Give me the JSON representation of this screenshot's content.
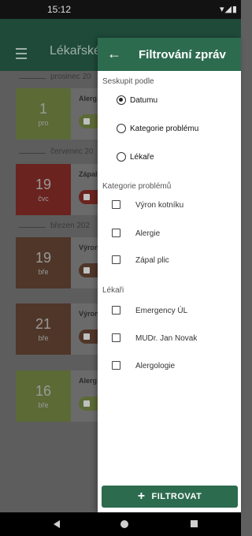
{
  "status_bar": {
    "time": "15:12",
    "icons": "▾◢▮"
  },
  "background_app": {
    "title": "Lékařské",
    "groups": [
      {
        "separator": "prosinec 20",
        "card": {
          "day": "1",
          "month": "pro",
          "title": "Alerg",
          "color": "#6b7a3a",
          "chip_color": "#6b7a3a"
        }
      },
      {
        "separator": "červenec 20",
        "card": {
          "day": "19",
          "month": "čvc",
          "title": "Zápal",
          "color": "#7a2b24",
          "chip_color": "#7a2b24"
        }
      },
      {
        "separator": "březen 202",
        "card": {
          "day": "19",
          "month": "bře",
          "title": "Výron",
          "color": "#5a3e2e",
          "chip_color": "#5a3e2e"
        }
      },
      {
        "separator": "",
        "card": {
          "day": "21",
          "month": "bře",
          "title": "Výron",
          "color": "#5a3e2e",
          "chip_color": "#5a3e2e"
        }
      },
      {
        "separator": "",
        "card": {
          "day": "16",
          "month": "bře",
          "title": "Alerg",
          "color": "#6b7a3a",
          "chip_color": "#6b7a3a"
        }
      }
    ]
  },
  "drawer": {
    "back_icon": "←",
    "title": "Filtrování zpráv",
    "group_by": {
      "label": "Seskupit podle",
      "options": [
        {
          "label": "Datumu",
          "selected": true
        },
        {
          "label": "Kategorie problému",
          "selected": false
        },
        {
          "label": "Lékaře",
          "selected": false
        }
      ]
    },
    "categories": {
      "label": "Kategorie problémů",
      "items": [
        {
          "label": "Výron kotníku",
          "checked": false
        },
        {
          "label": "Alergie",
          "checked": false
        },
        {
          "label": "Zápal plic",
          "checked": false
        }
      ]
    },
    "doctors": {
      "label": "Lékaři",
      "items": [
        {
          "label": "Emergency ÚL",
          "checked": false
        },
        {
          "label": "MUDr. Jan Novak",
          "checked": false
        },
        {
          "label": "Alergologie",
          "checked": false
        }
      ]
    },
    "filter_button": {
      "icon": "+",
      "label": "FILTROVAT"
    }
  },
  "nav_bar": {
    "back": "back-icon",
    "home": "home-icon",
    "recents": "recents-icon"
  },
  "colors": {
    "primary": "#2d6b4f",
    "appbar_dim": "#1f4a3a"
  }
}
